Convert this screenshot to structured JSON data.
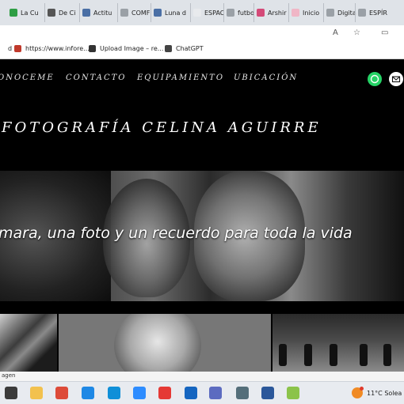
{
  "browser": {
    "tabs": [
      {
        "label": "La Cu",
        "color": "#2e9e44"
      },
      {
        "label": "De Ci",
        "color": "#555555"
      },
      {
        "label": "Actitu",
        "color": "#4a6fa5"
      },
      {
        "label": "COMF",
        "color": "#9aa0a6"
      },
      {
        "label": "Luna d",
        "color": "#4a6fa5"
      },
      {
        "label": "ESPAC",
        "color": "#e8eaed"
      },
      {
        "label": "futbo",
        "color": "#9aa0a6"
      },
      {
        "label": "Arshir",
        "color": "#d44a78"
      },
      {
        "label": "Inicio",
        "color": "#f0b6c6"
      },
      {
        "label": "Digita",
        "color": "#9aa0a6"
      },
      {
        "label": "ESPÍR",
        "color": "#9aa0a6"
      }
    ],
    "reader_mode_label": "A",
    "bookmarks": [
      {
        "label": "d",
        "color": "#ffffff"
      },
      {
        "label": "https://www.infore...",
        "color": "#c0392b"
      },
      {
        "label": "Upload Image – re...",
        "color": "#333333"
      },
      {
        "label": "ChatGPT",
        "color": "#444444"
      }
    ]
  },
  "site": {
    "nav": [
      "ONOCEME",
      "CONTACTO",
      "EQUIPAMIENTO",
      "UBICACIÓN"
    ],
    "social": [
      {
        "icon": "whatsapp-icon",
        "color": "#25d366"
      },
      {
        "icon": "mail-icon",
        "color": "#ffffff"
      }
    ],
    "brand": "FOTOGRAFÍA CELINA AGUIRRE",
    "tagline": "mara, una foto y un recuerdo para toda la vida"
  },
  "status_bar": {
    "text": "agen"
  },
  "taskbar": {
    "icons": [
      {
        "name": "search-icon",
        "color": "#3b3b3b"
      },
      {
        "name": "file-explorer-icon",
        "color": "#f2c14e"
      },
      {
        "name": "chrome-icon",
        "color": "#dd4b39"
      },
      {
        "name": "ie-icon",
        "color": "#1e88e5"
      },
      {
        "name": "edge-icon",
        "color": "#0f8fd8"
      },
      {
        "name": "zoom-icon",
        "color": "#2d8cff"
      },
      {
        "name": "no-entry-icon",
        "color": "#e53935"
      },
      {
        "name": "display-icon",
        "color": "#1565c0"
      },
      {
        "name": "network-icon",
        "color": "#5c6bc0"
      },
      {
        "name": "calculator-icon",
        "color": "#546e7a"
      },
      {
        "name": "word-icon",
        "color": "#2b579a"
      },
      {
        "name": "paint-icon",
        "color": "#8bc34a"
      }
    ],
    "temperature": "11°C",
    "weather": "Solea"
  }
}
